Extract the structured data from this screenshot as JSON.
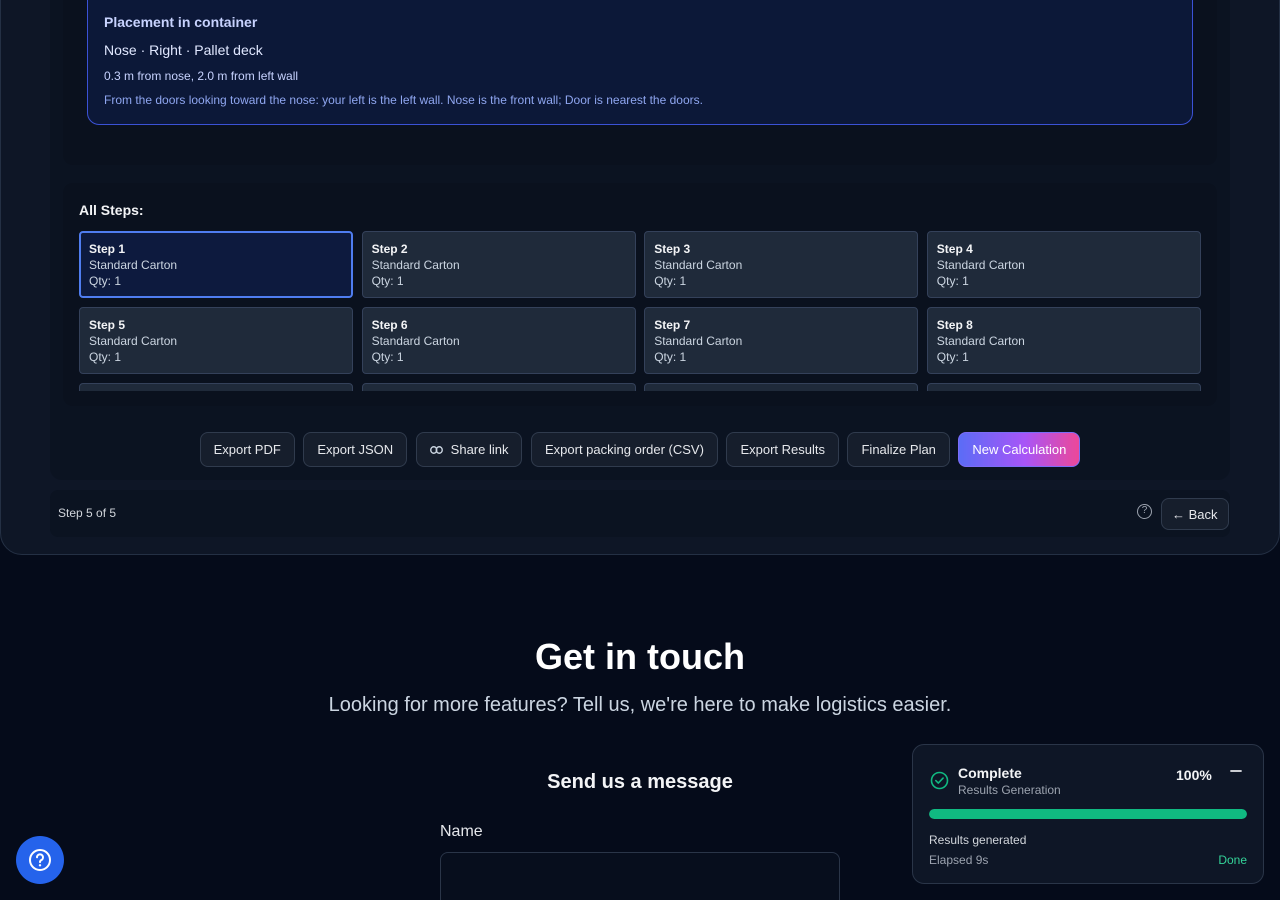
{
  "placement": {
    "title": "Placement in container",
    "main": "Nose · Right · Pallet deck",
    "distance": "0.3 m from nose, 2.0 m from left wall",
    "note": "From the doors looking toward the nose: your left is the left wall. Nose is the front wall; Door is nearest the doors."
  },
  "steps": {
    "title": "All Steps:",
    "items": [
      {
        "label": "Step 1",
        "type": "Standard Carton",
        "qty": "Qty: 1"
      },
      {
        "label": "Step 2",
        "type": "Standard Carton",
        "qty": "Qty: 1"
      },
      {
        "label": "Step 3",
        "type": "Standard Carton",
        "qty": "Qty: 1"
      },
      {
        "label": "Step 4",
        "type": "Standard Carton",
        "qty": "Qty: 1"
      },
      {
        "label": "Step 5",
        "type": "Standard Carton",
        "qty": "Qty: 1"
      },
      {
        "label": "Step 6",
        "type": "Standard Carton",
        "qty": "Qty: 1"
      },
      {
        "label": "Step 7",
        "type": "Standard Carton",
        "qty": "Qty: 1"
      },
      {
        "label": "Step 8",
        "type": "Standard Carton",
        "qty": "Qty: 1"
      },
      {
        "label": "",
        "type": "",
        "qty": ""
      },
      {
        "label": "",
        "type": "",
        "qty": ""
      },
      {
        "label": "",
        "type": "",
        "qty": ""
      },
      {
        "label": "",
        "type": "",
        "qty": ""
      }
    ]
  },
  "actions": {
    "export_pdf": "Export PDF",
    "export_json": "Export JSON",
    "share_link": "Share link",
    "export_csv": "Export packing order (CSV)",
    "export_results": "Export Results",
    "finalize": "Finalize Plan",
    "new_calc": "New Calculation"
  },
  "footer": {
    "step_counter": "Step 5 of 5",
    "back": "← Back"
  },
  "contact": {
    "title": "Get in touch",
    "subtitle": "Looking for more features? Tell us, we're here to make logistics easier.",
    "form_title": "Send us a message",
    "name_label": "Name",
    "name_value": ""
  },
  "toast": {
    "title": "Complete",
    "subtitle": "Results Generation",
    "percent": "100%",
    "progress": 1.0,
    "message": "Results generated",
    "elapsed": "Elapsed 9s",
    "status": "Done"
  },
  "colors": {
    "accent": "#2563eb",
    "success": "#10b981",
    "active_border": "#4f7df0"
  }
}
